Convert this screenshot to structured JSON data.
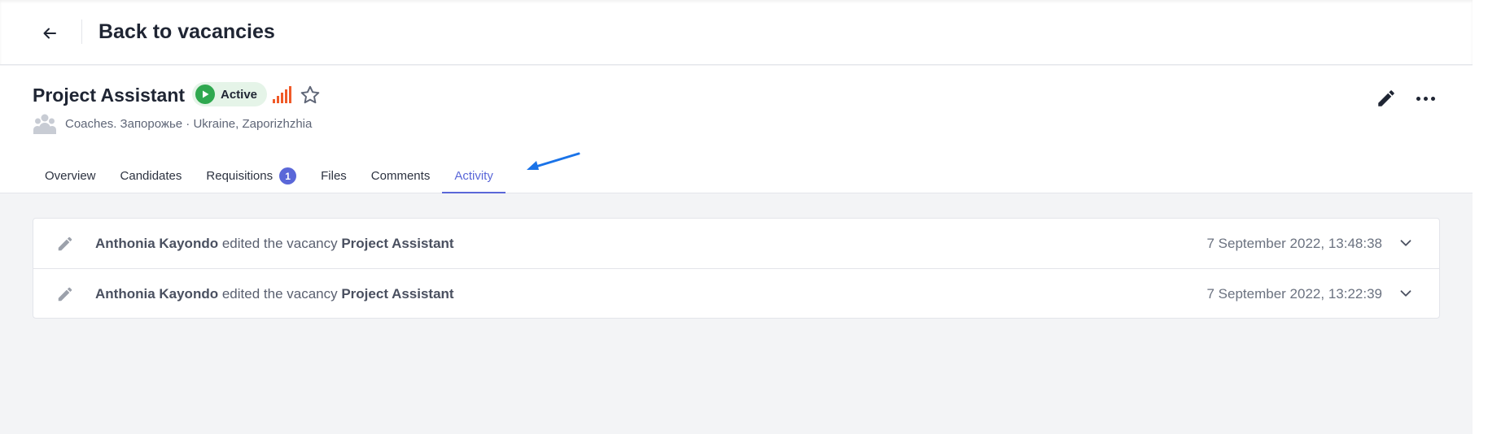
{
  "header": {
    "back_label": "Back to vacancies"
  },
  "vacancy": {
    "title": "Project Assistant",
    "status": "Active",
    "subtitle": "Coaches. Запорожье · Ukraine, Zaporizhzhia",
    "signal_bars": 5
  },
  "tabs": [
    {
      "label": "Overview"
    },
    {
      "label": "Candidates"
    },
    {
      "label": "Requisitions",
      "count": "1"
    },
    {
      "label": "Files"
    },
    {
      "label": "Comments"
    },
    {
      "label": "Activity",
      "active": true
    }
  ],
  "activity": [
    {
      "user": "Anthonia Kayondo",
      "action": "edited the vacancy",
      "target": "Project Assistant",
      "time": "7 September 2022, 13:48:38"
    },
    {
      "user": "Anthonia Kayondo",
      "action": "edited the vacancy",
      "target": "Project Assistant",
      "time": "7 September 2022, 13:22:39"
    }
  ],
  "colors": {
    "accent": "#5a67d8",
    "status_green": "#2fa84f",
    "signal_orange": "#f05a28",
    "annotation_arrow": "#1a73e8"
  },
  "icons": {
    "back": "arrow-left-icon",
    "status": "play-icon",
    "priority": "signal-bars-icon",
    "favorite": "star-icon",
    "team": "people-icon",
    "edit": "pencil-icon",
    "more": "more-horizontal-icon",
    "activity_row": "pencil-icon",
    "expand": "chevron-down-icon"
  }
}
